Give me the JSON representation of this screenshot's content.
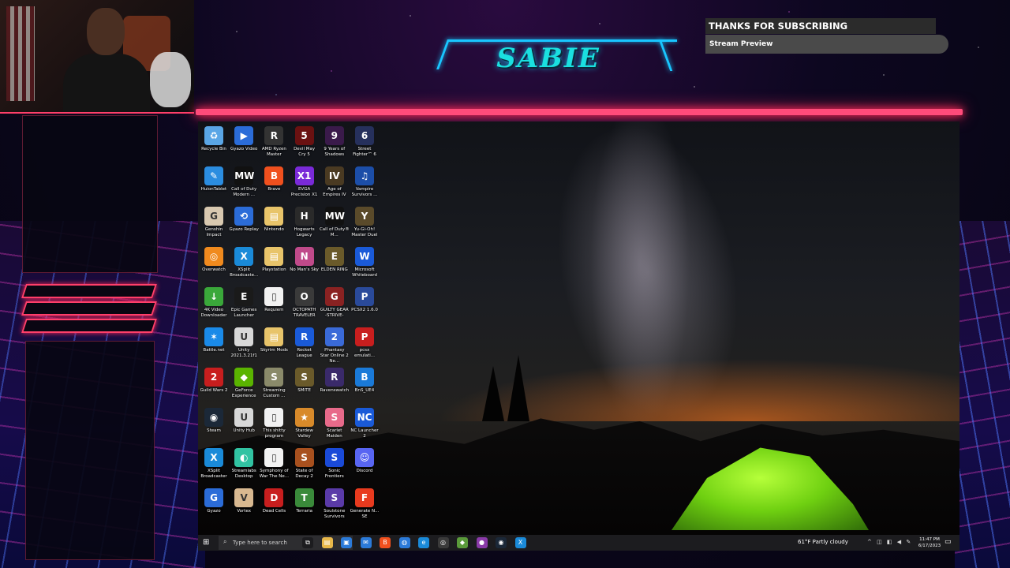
{
  "overlay": {
    "logo_text": "SABIE",
    "notification_title": "THANKS FOR SUBSCRIBING",
    "notification_subtitle": "Stream Preview"
  },
  "desktop": {
    "icons": [
      {
        "label": "Recycle Bin",
        "icon": "recycle-bin-icon",
        "color": "#5aa6e6",
        "glyph": "♻"
      },
      {
        "label": "Gyazo Video",
        "icon": "gyazo-video-icon",
        "color": "#2b6cd8",
        "glyph": "▶"
      },
      {
        "label": "AMD Ryzen Master",
        "icon": "amd-ryzen-icon",
        "color": "#333333",
        "glyph": "R"
      },
      {
        "label": "Devil May Cry 5",
        "icon": "dmc5-icon",
        "color": "#6a1111",
        "glyph": "5"
      },
      {
        "label": "9 Years of Shadows",
        "icon": "nine-years-icon",
        "color": "#3a1a4a",
        "glyph": "9"
      },
      {
        "label": "Street Fighter™ 6",
        "icon": "street-fighter-icon",
        "color": "#26305c",
        "glyph": "6"
      },
      {
        "label": "HuionTablet",
        "icon": "huion-icon",
        "color": "#2b8de0",
        "glyph": "✎"
      },
      {
        "label": "Call of Duty Modern ...",
        "icon": "cod-mw-icon",
        "color": "#111111",
        "glyph": "MW"
      },
      {
        "label": "Brave",
        "icon": "brave-icon",
        "color": "#f0501e",
        "glyph": "B"
      },
      {
        "label": "EVGA Precision X1",
        "icon": "evga-icon",
        "color": "#7a2ad8",
        "glyph": "X1"
      },
      {
        "label": "Age of Empires IV",
        "icon": "aoe-icon",
        "color": "#4a3a22",
        "glyph": "IV"
      },
      {
        "label": "Vampire Survivors ...",
        "icon": "vampire-survivors-icon",
        "color": "#1c4ea8",
        "glyph": "♫"
      },
      {
        "label": "Genshin Impact",
        "icon": "genshin-icon",
        "color": "#d8c8b0",
        "glyph": "G"
      },
      {
        "label": "Gyazo Replay",
        "icon": "gyazo-replay-icon",
        "color": "#2b6cd8",
        "glyph": "⟲"
      },
      {
        "label": "Nintendo",
        "icon": "folder-icon",
        "color": "#e8c46a",
        "glyph": "▤"
      },
      {
        "label": "Hogwarts Legacy",
        "icon": "hogwarts-icon",
        "color": "#2a2a2a",
        "glyph": "H"
      },
      {
        "label": "Call of Duty® M...",
        "icon": "cod-mw2-icon",
        "color": "#111111",
        "glyph": "MW"
      },
      {
        "label": "Yu-Gi-Oh! Master Duel",
        "icon": "yugioh-icon",
        "color": "#5a4a2a",
        "glyph": "Y"
      },
      {
        "label": "Overwatch",
        "icon": "overwatch-icon",
        "color": "#f08a1e",
        "glyph": "◎"
      },
      {
        "label": "XSplit Broadcaste...",
        "icon": "xsplit-icon",
        "color": "#1a8ad8",
        "glyph": "X"
      },
      {
        "label": "Playstation",
        "icon": "folder-icon",
        "color": "#e8c46a",
        "glyph": "▤"
      },
      {
        "label": "No Man's Sky",
        "icon": "no-mans-sky-icon",
        "color": "#c04a8a",
        "glyph": "N"
      },
      {
        "label": "ELDEN RING",
        "icon": "elden-ring-icon",
        "color": "#6a5a2a",
        "glyph": "E"
      },
      {
        "label": "Microsoft Whiteboard",
        "icon": "whiteboard-icon",
        "color": "#1a5ad8",
        "glyph": "W"
      },
      {
        "label": "4K Video Downloader",
        "icon": "video-downloader-icon",
        "color": "#3aa83a",
        "glyph": "↓"
      },
      {
        "label": "Epic Games Launcher",
        "icon": "epic-games-icon",
        "color": "#1a1a1a",
        "glyph": "E"
      },
      {
        "label": "Requiem",
        "icon": "document-icon",
        "color": "#f2f2f2",
        "glyph": "▯"
      },
      {
        "label": "OCTOPATH TRAVELER",
        "icon": "octopath-icon",
        "color": "#3a3a3a",
        "glyph": "O"
      },
      {
        "label": "GUILTY GEAR -STRIVE-",
        "icon": "guilty-gear-icon",
        "color": "#8a2222",
        "glyph": "G"
      },
      {
        "label": "PCSX2 1.6.0",
        "icon": "pcsx2-icon",
        "color": "#2a4a9a",
        "glyph": "P"
      },
      {
        "label": "Battle.net",
        "icon": "battlenet-icon",
        "color": "#1a8ae8",
        "glyph": "✶"
      },
      {
        "label": "Unity 2021.3.21f1",
        "icon": "unity-icon",
        "color": "#d8d8d8",
        "glyph": "U"
      },
      {
        "label": "Skyrim Mods",
        "icon": "folder-icon",
        "color": "#e8c46a",
        "glyph": "▤"
      },
      {
        "label": "Rocket League",
        "icon": "rocket-league-icon",
        "color": "#1a5ad8",
        "glyph": "R"
      },
      {
        "label": "Phantasy Star Online 2 Ne...",
        "icon": "pso2-icon",
        "color": "#3a6ad8",
        "glyph": "2"
      },
      {
        "label": "pcsx emulati...",
        "icon": "pcsx-emu-icon",
        "color": "#c81e1e",
        "glyph": "P"
      },
      {
        "label": "Guild Wars 2",
        "icon": "guild-wars-icon",
        "color": "#c81e1e",
        "glyph": "2"
      },
      {
        "label": "GeForce Experience",
        "icon": "geforce-icon",
        "color": "#5ab400",
        "glyph": "◆"
      },
      {
        "label": "Streaming Custom ...",
        "icon": "streaming-custom-icon",
        "color": "#8a8a6a",
        "glyph": "S"
      },
      {
        "label": "SMITE",
        "icon": "smite-icon",
        "color": "#6a5a2a",
        "glyph": "S"
      },
      {
        "label": "Ravenswatch",
        "icon": "ravenswatch-icon",
        "color": "#3a2a6a",
        "glyph": "R"
      },
      {
        "label": "BnS_UE4",
        "icon": "bns-icon",
        "color": "#1a7ad8",
        "glyph": "B"
      },
      {
        "label": "Steam",
        "icon": "steam-icon",
        "color": "#1b2838",
        "glyph": "◉"
      },
      {
        "label": "Unity Hub",
        "icon": "unity-hub-icon",
        "color": "#d8d8d8",
        "glyph": "U"
      },
      {
        "label": "This shitty program",
        "icon": "document-icon",
        "color": "#f2f2f2",
        "glyph": "▯"
      },
      {
        "label": "Stardew Valley",
        "icon": "stardew-icon",
        "color": "#d88a2a",
        "glyph": "★"
      },
      {
        "label": "Scarlet Maiden",
        "icon": "scarlet-maiden-icon",
        "color": "#e86a8a",
        "glyph": "S"
      },
      {
        "label": "NC Launcher 2",
        "icon": "nc-launcher-icon",
        "color": "#1a5ad8",
        "glyph": "NC"
      },
      {
        "label": "XSplit Broadcaster",
        "icon": "xsplit-broadcaster-icon",
        "color": "#1a8ad8",
        "glyph": "X"
      },
      {
        "label": "Streamlabs Desktop",
        "icon": "streamlabs-icon",
        "color": "#31c3a2",
        "glyph": "◐"
      },
      {
        "label": "Symphony of War The Ne...",
        "icon": "document-icon",
        "color": "#f2f2f2",
        "glyph": "▯"
      },
      {
        "label": "State of Decay 2",
        "icon": "state-of-decay-icon",
        "color": "#a8501e",
        "glyph": "S"
      },
      {
        "label": "Sonic Frontiers",
        "icon": "sonic-icon",
        "color": "#1a4ad8",
        "glyph": "S"
      },
      {
        "label": "Discord",
        "icon": "discord-icon",
        "color": "#5865f2",
        "glyph": "☺"
      },
      {
        "label": "Gyazo",
        "icon": "gyazo-icon",
        "color": "#2b6cd8",
        "glyph": "G"
      },
      {
        "label": "Vortex",
        "icon": "vortex-icon",
        "color": "#d8b890",
        "glyph": "V"
      },
      {
        "label": "Dead Cells",
        "icon": "dead-cells-icon",
        "color": "#c81e1e",
        "glyph": "D"
      },
      {
        "label": "Terraria",
        "icon": "terraria-icon",
        "color": "#3a8a3a",
        "glyph": "T"
      },
      {
        "label": "Soulstone Survivors",
        "icon": "soulstone-icon",
        "color": "#5a3aa8",
        "glyph": "S"
      },
      {
        "label": "Generate N... SE",
        "icon": "generate-icon",
        "color": "#e83a1e",
        "glyph": "F"
      }
    ]
  },
  "taskbar": {
    "search_placeholder": "Type here to search",
    "weather": "61°F  Partly cloudy",
    "time": "11:47 PM",
    "date": "6/17/2023",
    "pinned": [
      {
        "icon": "task-view-icon",
        "color": "#1c1c1f",
        "glyph": "⧉"
      },
      {
        "icon": "file-explorer-icon",
        "color": "#e8b84a",
        "glyph": "▤"
      },
      {
        "icon": "store-icon",
        "color": "#2b7ad8",
        "glyph": "▣"
      },
      {
        "icon": "mail-icon",
        "color": "#2b7ad8",
        "glyph": "✉"
      },
      {
        "icon": "brave-taskbar-icon",
        "color": "#f0501e",
        "glyph": "B"
      },
      {
        "icon": "chrome-icon",
        "color": "#2b7ad8",
        "glyph": "◍"
      },
      {
        "icon": "edge-icon",
        "color": "#1a8ad8",
        "glyph": "e"
      },
      {
        "icon": "browser-icon",
        "color": "#3a3a3a",
        "glyph": "◎"
      },
      {
        "icon": "minecraft-icon",
        "color": "#5a9a3a",
        "glyph": "◆"
      },
      {
        "icon": "obs-icon",
        "color": "#8a3aa8",
        "glyph": "●"
      },
      {
        "icon": "steam-taskbar-icon",
        "color": "#1b2838",
        "glyph": "◉"
      },
      {
        "icon": "xsplit-taskbar-icon",
        "color": "#1a8ad8",
        "glyph": "X"
      }
    ]
  }
}
